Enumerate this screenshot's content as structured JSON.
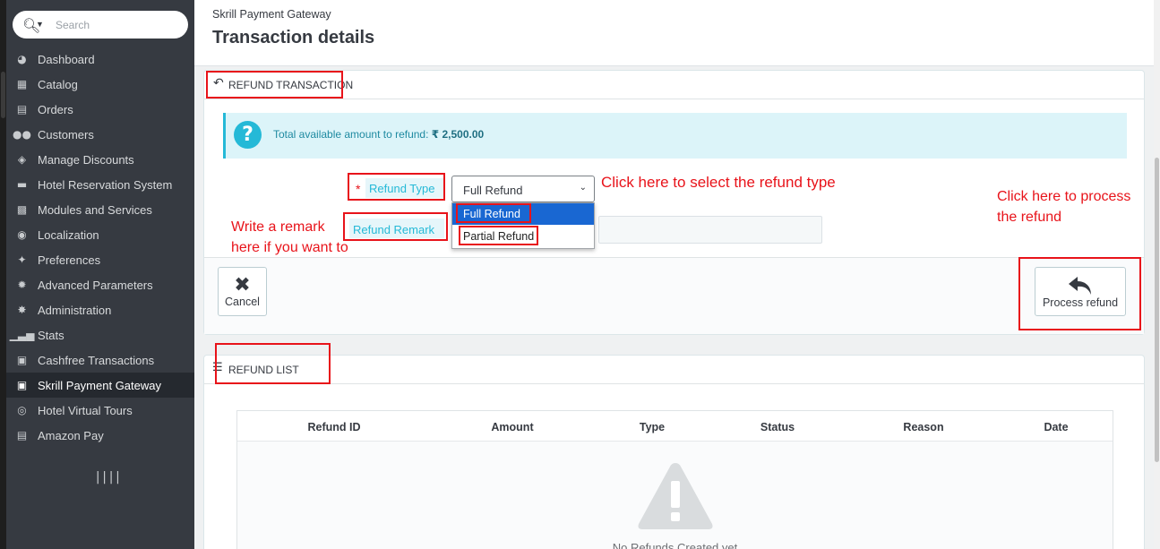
{
  "search": {
    "placeholder": "Search"
  },
  "sidebar": {
    "items": [
      {
        "label": "Dashboard",
        "icon": "dashboard-icon"
      },
      {
        "label": "Catalog",
        "icon": "book-icon"
      },
      {
        "label": "Orders",
        "icon": "credit-card-icon"
      },
      {
        "label": "Customers",
        "icon": "users-icon"
      },
      {
        "label": "Manage Discounts",
        "icon": "tags-icon"
      },
      {
        "label": "Hotel Reservation System",
        "icon": "bed-icon"
      },
      {
        "label": "Modules and Services",
        "icon": "puzzle-icon"
      },
      {
        "label": "Localization",
        "icon": "globe-icon"
      },
      {
        "label": "Preferences",
        "icon": "wrench-icon"
      },
      {
        "label": "Advanced Parameters",
        "icon": "cogs-icon"
      },
      {
        "label": "Administration",
        "icon": "cog-icon"
      },
      {
        "label": "Stats",
        "icon": "bar-chart-icon"
      },
      {
        "label": "Cashfree Transactions",
        "icon": "money-icon"
      },
      {
        "label": "Skrill Payment Gateway",
        "icon": "money-icon",
        "active": true
      },
      {
        "label": "Hotel Virtual Tours",
        "icon": "compass-icon"
      },
      {
        "label": "Amazon Pay",
        "icon": "credit-card-icon"
      }
    ]
  },
  "header": {
    "breadcrumb": "Skrill Payment Gateway",
    "title": "Transaction details"
  },
  "refund_panel": {
    "heading": "REFUND TRANSACTION",
    "info_text": "Total available amount to refund: ",
    "info_amount": "₹ 2,500.00",
    "refund_type_label": "Refund Type",
    "refund_type_value": "Full Refund",
    "refund_type_options": [
      "Full Refund",
      "Partial Refund"
    ],
    "refund_remark_label": "Refund Remark",
    "cancel_label": "Cancel",
    "process_label": "Process refund"
  },
  "list_panel": {
    "heading": "REFUND LIST",
    "columns": [
      "Refund ID",
      "Amount",
      "Type",
      "Status",
      "Reason",
      "Date"
    ],
    "empty_text": "No Refunds Created yet"
  },
  "annotations": {
    "select_hint": "Click here to select the refund type",
    "process_hint_1": "Click here to process",
    "process_hint_2": "the refund",
    "remark_hint_1": "Write a remark",
    "remark_hint_2": "here if you want to"
  },
  "colors": {
    "sidebar": "#363a41",
    "accent": "#25b9d7",
    "annotation_red": "#e8131a",
    "dropdown_selected": "#1967d2"
  }
}
